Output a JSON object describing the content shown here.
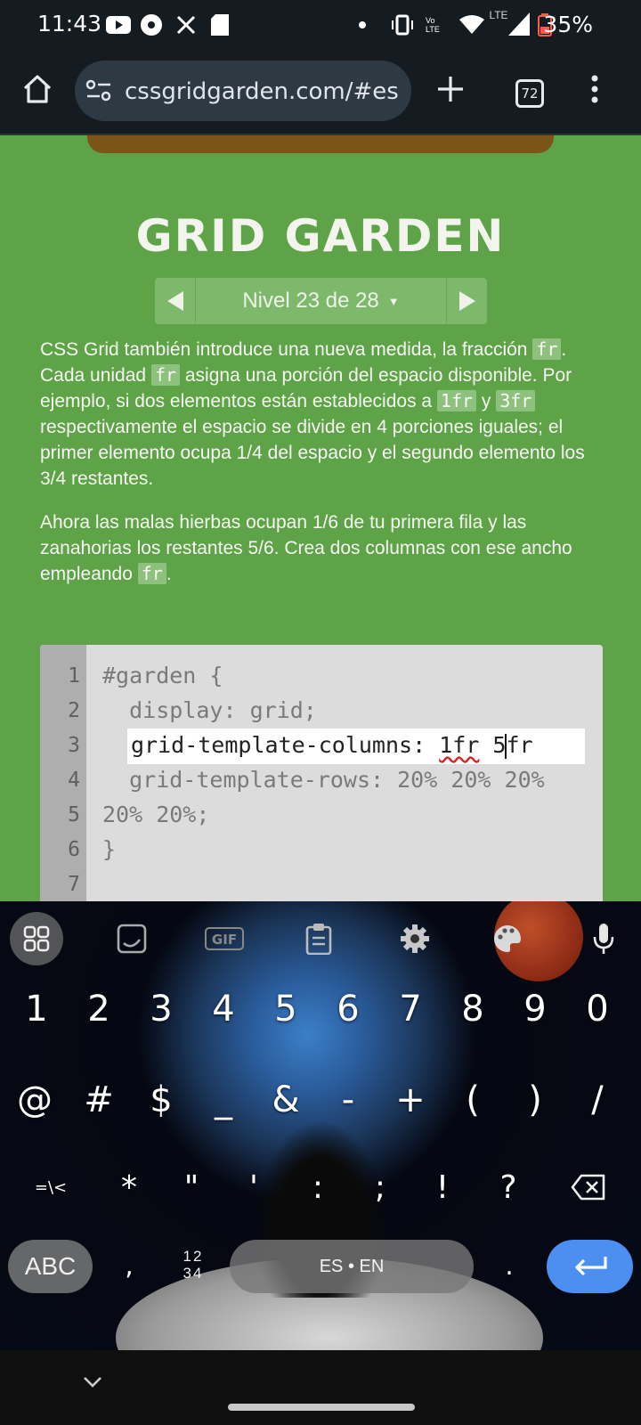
{
  "status_bar": {
    "time": "11:43",
    "battery": "35%",
    "network": "LTE",
    "volte": "Vo LTE"
  },
  "browser": {
    "url": "cssgridgarden.com/#es",
    "tab_count": "72"
  },
  "page": {
    "title": "GRID GARDEN",
    "level_label": "Nivel 23 de 28",
    "level_caret": "▼",
    "paragraph1": {
      "t1": "CSS Grid también introduce una nueva medida, la fracción ",
      "c1": "fr",
      "t2": ". Cada unidad ",
      "c2": "fr",
      "t3": " asigna una porción del espacio disponible. Por ejemplo, si dos elementos están establecidos a ",
      "c3": "1fr",
      "t4": " y ",
      "c4": "3fr",
      "t5": " respectivamente el espacio se divide en 4 porciones iguales; el primer elemento ocupa 1/4 del espacio y el segundo elemento los 3/4 restantes."
    },
    "paragraph2": {
      "t1": "Ahora las malas hierbas ocupan 1/6 de tu primera fila y las zanahorias los restantes 5/6. Crea dos columnas con ese ancho empleando ",
      "c1": "fr",
      "t2": "."
    }
  },
  "editor": {
    "line_numbers": [
      "1",
      "2",
      "3",
      "4",
      "5",
      "6",
      "7"
    ],
    "line1": "#garden {",
    "line2": "  display: grid;",
    "input_prefix": "grid-template-columns: ",
    "input_squiggle": "1fr",
    "input_mid": " 5",
    "input_suffix": "fr",
    "line4": "  grid-template-rows: 20% 20% 20%",
    "line5": "20% 20%;",
    "line6": "}"
  },
  "keyboard": {
    "row1": [
      "1",
      "2",
      "3",
      "4",
      "5",
      "6",
      "7",
      "8",
      "9",
      "0"
    ],
    "row2": [
      "@",
      "#",
      "$",
      "_",
      "&",
      "-",
      "+",
      "(",
      ")",
      "/"
    ],
    "row3": [
      "=\\<",
      "*",
      "\"",
      "'",
      ":",
      ";",
      "!",
      "?"
    ],
    "abc": "ABC",
    "comma": ",",
    "numpad_top": "12",
    "numpad_bottom": "34",
    "space": "ES • EN",
    "period": ".",
    "accent_color": "#4c8ff0"
  }
}
